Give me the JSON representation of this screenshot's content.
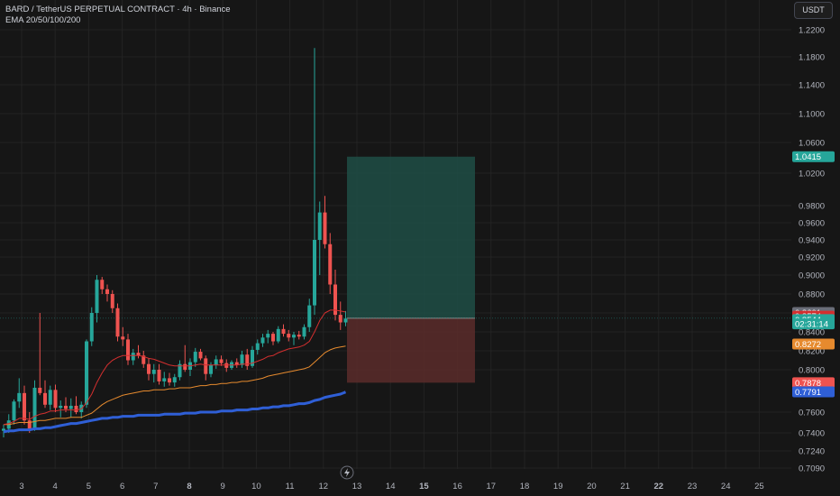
{
  "header": {
    "symbol_line": "BARD / TetherUS PERPETUAL CONTRACT · 4h · Binance",
    "indicator_line": "EMA 20/50/100/200"
  },
  "currency_button": "USDT",
  "colors": {
    "up": "#26a69a",
    "down": "#ef5350",
    "ema_fast": "#d32f2f",
    "ema_mid": "#e68a2e",
    "ema_slow": "#2f5fd6",
    "grid": "#232323",
    "profit_zone": "#1f4d45",
    "loss_zone": "#5a2c2a"
  },
  "chart_data": {
    "type": "candlestick",
    "y_ticks": [
      "1.2200",
      "1.1800",
      "1.1400",
      "1.1000",
      "1.0600",
      "1.0200",
      "0.9800",
      "0.9600",
      "0.9400",
      "0.9200",
      "0.9000",
      "0.8800",
      "0.8600",
      "0.8400",
      "0.8200",
      "0.8000",
      "0.7600",
      "0.7400",
      "0.7240",
      "0.7090"
    ],
    "x_ticks": [
      "3",
      "4",
      "5",
      "6",
      "7",
      "8",
      "9",
      "10",
      "11",
      "12",
      "13",
      "14",
      "15",
      "16",
      "17",
      "18",
      "19",
      "20",
      "21",
      "22",
      "23",
      "24",
      "25"
    ],
    "bold_x_ticks": [
      "8",
      "15",
      "22"
    ],
    "candles": [
      {
        "o": 0.742,
        "h": 0.748,
        "l": 0.736,
        "c": 0.744
      },
      {
        "o": 0.744,
        "h": 0.758,
        "l": 0.74,
        "c": 0.752
      },
      {
        "o": 0.752,
        "h": 0.772,
        "l": 0.748,
        "c": 0.77
      },
      {
        "o": 0.77,
        "h": 0.792,
        "l": 0.764,
        "c": 0.778
      },
      {
        "o": 0.778,
        "h": 0.785,
        "l": 0.748,
        "c": 0.752
      },
      {
        "o": 0.752,
        "h": 0.76,
        "l": 0.74,
        "c": 0.744
      },
      {
        "o": 0.744,
        "h": 0.79,
        "l": 0.742,
        "c": 0.783
      },
      {
        "o": 0.783,
        "h": 0.86,
        "l": 0.776,
        "c": 0.778
      },
      {
        "o": 0.778,
        "h": 0.79,
        "l": 0.764,
        "c": 0.767
      },
      {
        "o": 0.767,
        "h": 0.785,
        "l": 0.762,
        "c": 0.781
      },
      {
        "o": 0.781,
        "h": 0.786,
        "l": 0.76,
        "c": 0.764
      },
      {
        "o": 0.764,
        "h": 0.771,
        "l": 0.755,
        "c": 0.766
      },
      {
        "o": 0.766,
        "h": 0.774,
        "l": 0.76,
        "c": 0.763
      },
      {
        "o": 0.763,
        "h": 0.773,
        "l": 0.755,
        "c": 0.766
      },
      {
        "o": 0.766,
        "h": 0.775,
        "l": 0.758,
        "c": 0.76
      },
      {
        "o": 0.76,
        "h": 0.77,
        "l": 0.754,
        "c": 0.767
      },
      {
        "o": 0.767,
        "h": 0.832,
        "l": 0.764,
        "c": 0.83
      },
      {
        "o": 0.83,
        "h": 0.866,
        "l": 0.825,
        "c": 0.86
      },
      {
        "o": 0.86,
        "h": 0.9,
        "l": 0.85,
        "c": 0.895
      },
      {
        "o": 0.895,
        "h": 0.898,
        "l": 0.88,
        "c": 0.885
      },
      {
        "o": 0.885,
        "h": 0.89,
        "l": 0.872,
        "c": 0.88
      },
      {
        "o": 0.88,
        "h": 0.884,
        "l": 0.86,
        "c": 0.865
      },
      {
        "o": 0.865,
        "h": 0.87,
        "l": 0.83,
        "c": 0.835
      },
      {
        "o": 0.835,
        "h": 0.845,
        "l": 0.825,
        "c": 0.832
      },
      {
        "o": 0.832,
        "h": 0.838,
        "l": 0.805,
        "c": 0.81
      },
      {
        "o": 0.81,
        "h": 0.822,
        "l": 0.805,
        "c": 0.818
      },
      {
        "o": 0.818,
        "h": 0.826,
        "l": 0.812,
        "c": 0.815
      },
      {
        "o": 0.815,
        "h": 0.82,
        "l": 0.802,
        "c": 0.806
      },
      {
        "o": 0.806,
        "h": 0.812,
        "l": 0.79,
        "c": 0.796
      },
      {
        "o": 0.796,
        "h": 0.806,
        "l": 0.788,
        "c": 0.8
      },
      {
        "o": 0.8,
        "h": 0.806,
        "l": 0.786,
        "c": 0.789
      },
      {
        "o": 0.789,
        "h": 0.798,
        "l": 0.784,
        "c": 0.792
      },
      {
        "o": 0.792,
        "h": 0.797,
        "l": 0.785,
        "c": 0.788
      },
      {
        "o": 0.788,
        "h": 0.796,
        "l": 0.784,
        "c": 0.793
      },
      {
        "o": 0.793,
        "h": 0.81,
        "l": 0.79,
        "c": 0.806
      },
      {
        "o": 0.806,
        "h": 0.826,
        "l": 0.798,
        "c": 0.8
      },
      {
        "o": 0.8,
        "h": 0.812,
        "l": 0.794,
        "c": 0.808
      },
      {
        "o": 0.808,
        "h": 0.823,
        "l": 0.803,
        "c": 0.819
      },
      {
        "o": 0.819,
        "h": 0.822,
        "l": 0.81,
        "c": 0.812
      },
      {
        "o": 0.812,
        "h": 0.815,
        "l": 0.79,
        "c": 0.796
      },
      {
        "o": 0.796,
        "h": 0.808,
        "l": 0.793,
        "c": 0.805
      },
      {
        "o": 0.805,
        "h": 0.815,
        "l": 0.801,
        "c": 0.811
      },
      {
        "o": 0.811,
        "h": 0.815,
        "l": 0.804,
        "c": 0.807
      },
      {
        "o": 0.807,
        "h": 0.811,
        "l": 0.798,
        "c": 0.802
      },
      {
        "o": 0.802,
        "h": 0.81,
        "l": 0.8,
        "c": 0.808
      },
      {
        "o": 0.808,
        "h": 0.812,
        "l": 0.802,
        "c": 0.805
      },
      {
        "o": 0.805,
        "h": 0.82,
        "l": 0.802,
        "c": 0.816
      },
      {
        "o": 0.816,
        "h": 0.822,
        "l": 0.8,
        "c": 0.804
      },
      {
        "o": 0.804,
        "h": 0.825,
        "l": 0.802,
        "c": 0.821
      },
      {
        "o": 0.821,
        "h": 0.832,
        "l": 0.816,
        "c": 0.828
      },
      {
        "o": 0.828,
        "h": 0.838,
        "l": 0.824,
        "c": 0.834
      },
      {
        "o": 0.834,
        "h": 0.842,
        "l": 0.828,
        "c": 0.838
      },
      {
        "o": 0.838,
        "h": 0.84,
        "l": 0.826,
        "c": 0.83
      },
      {
        "o": 0.83,
        "h": 0.846,
        "l": 0.828,
        "c": 0.843
      },
      {
        "o": 0.843,
        "h": 0.848,
        "l": 0.835,
        "c": 0.838
      },
      {
        "o": 0.838,
        "h": 0.842,
        "l": 0.83,
        "c": 0.834
      },
      {
        "o": 0.834,
        "h": 0.84,
        "l": 0.826,
        "c": 0.837
      },
      {
        "o": 0.837,
        "h": 0.841,
        "l": 0.832,
        "c": 0.835
      },
      {
        "o": 0.835,
        "h": 0.848,
        "l": 0.832,
        "c": 0.845
      },
      {
        "o": 0.845,
        "h": 0.875,
        "l": 0.84,
        "c": 0.868
      },
      {
        "o": 0.868,
        "h": 1.193,
        "l": 0.858,
        "c": 0.94
      },
      {
        "o": 0.94,
        "h": 0.985,
        "l": 0.9,
        "c": 0.972
      },
      {
        "o": 0.972,
        "h": 0.992,
        "l": 0.93,
        "c": 0.935
      },
      {
        "o": 0.935,
        "h": 0.948,
        "l": 0.88,
        "c": 0.89
      },
      {
        "o": 0.89,
        "h": 0.906,
        "l": 0.852,
        "c": 0.858
      },
      {
        "o": 0.858,
        "h": 0.872,
        "l": 0.842,
        "c": 0.85
      },
      {
        "o": 0.85,
        "h": 0.862,
        "l": 0.846,
        "c": 0.854
      }
    ],
    "ema_fast_values": [
      0.748,
      0.749,
      0.751,
      0.754,
      0.754,
      0.753,
      0.756,
      0.758,
      0.759,
      0.761,
      0.761,
      0.762,
      0.762,
      0.762,
      0.762,
      0.763,
      0.769,
      0.777,
      0.788,
      0.797,
      0.805,
      0.81,
      0.813,
      0.815,
      0.815,
      0.815,
      0.815,
      0.814,
      0.812,
      0.811,
      0.809,
      0.807,
      0.805,
      0.804,
      0.804,
      0.804,
      0.804,
      0.805,
      0.806,
      0.805,
      0.805,
      0.805,
      0.805,
      0.805,
      0.805,
      0.805,
      0.806,
      0.806,
      0.807,
      0.809,
      0.811,
      0.814,
      0.815,
      0.818,
      0.82,
      0.822,
      0.823,
      0.824,
      0.826,
      0.83,
      0.84,
      0.852,
      0.86,
      0.863,
      0.863,
      0.862,
      0.861
    ],
    "ema_mid_values": [
      0.748,
      0.748,
      0.749,
      0.75,
      0.75,
      0.75,
      0.751,
      0.752,
      0.752,
      0.753,
      0.754,
      0.754,
      0.754,
      0.755,
      0.755,
      0.755,
      0.757,
      0.759,
      0.763,
      0.767,
      0.77,
      0.772,
      0.774,
      0.776,
      0.777,
      0.778,
      0.779,
      0.78,
      0.78,
      0.781,
      0.781,
      0.781,
      0.782,
      0.782,
      0.783,
      0.783,
      0.783,
      0.784,
      0.785,
      0.785,
      0.786,
      0.786,
      0.787,
      0.787,
      0.788,
      0.788,
      0.789,
      0.789,
      0.79,
      0.791,
      0.792,
      0.794,
      0.795,
      0.796,
      0.797,
      0.798,
      0.799,
      0.8,
      0.801,
      0.803,
      0.808,
      0.813,
      0.818,
      0.821,
      0.823,
      0.824,
      0.825
    ],
    "ema_slow_values": [
      0.741,
      0.742,
      0.742,
      0.743,
      0.743,
      0.743,
      0.744,
      0.744,
      0.745,
      0.745,
      0.746,
      0.747,
      0.748,
      0.749,
      0.749,
      0.75,
      0.751,
      0.752,
      0.753,
      0.754,
      0.754,
      0.755,
      0.755,
      0.756,
      0.756,
      0.756,
      0.757,
      0.757,
      0.757,
      0.757,
      0.757,
      0.758,
      0.758,
      0.758,
      0.758,
      0.759,
      0.759,
      0.759,
      0.76,
      0.76,
      0.76,
      0.76,
      0.761,
      0.761,
      0.761,
      0.762,
      0.762,
      0.762,
      0.763,
      0.763,
      0.764,
      0.764,
      0.765,
      0.765,
      0.766,
      0.766,
      0.767,
      0.768,
      0.768,
      0.769,
      0.771,
      0.772,
      0.774,
      0.775,
      0.776,
      0.777,
      0.779
    ],
    "position": {
      "entry": 0.8544,
      "take_profit": 1.0415,
      "stop_loss": 0.7878
    },
    "price_labels": [
      {
        "text": "1.0415",
        "value": 1.0415,
        "bg": "#26a69a",
        "fg": "#ffffff"
      },
      {
        "text": "0.8601",
        "value": 0.8605,
        "bg": "#6a6d78",
        "fg": "#ffffff"
      },
      {
        "text": "0.8574",
        "value": 0.8565,
        "bg": "#d32f2f",
        "fg": "#ffffff"
      },
      {
        "text": "0.8544",
        "value": 0.853,
        "bg": "#26a69a",
        "fg": "#ffffff"
      },
      {
        "text": "02:31:14",
        "value": 0.8485,
        "bg": "#26a69a",
        "fg": "#ffffff"
      },
      {
        "text": "0.8272",
        "value": 0.8272,
        "bg": "#e68a2e",
        "fg": "#ffffff"
      },
      {
        "text": "0.7878",
        "value": 0.7878,
        "bg": "#ef5350",
        "fg": "#ffffff"
      },
      {
        "text": "0.7791",
        "value": 0.7791,
        "bg": "#2f5fd6",
        "fg": "#ffffff"
      }
    ]
  }
}
